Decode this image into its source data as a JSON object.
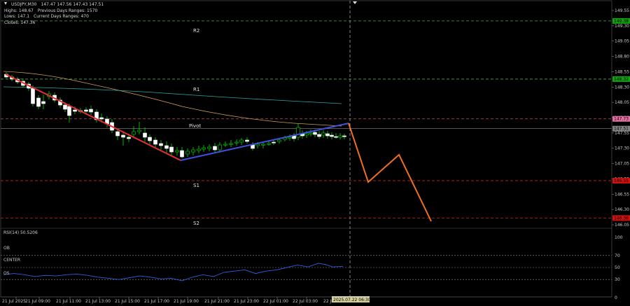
{
  "window": {
    "symbol": "USDJPY,M30",
    "ohlc": "147.47 147.56 147.43 147.51",
    "highs_label": "Highs: 148.67",
    "prev_range_label": "Previous Days Ranges: 1570",
    "lows_label": "Lows: 147.1",
    "curr_range_label": "Current Days Ranges: 470",
    "closes_label": "Closes: 147.36"
  },
  "levels": {
    "r2": "R2",
    "r1": "R1",
    "pivot": "Pivot",
    "s1": "S1",
    "s2": "S2"
  },
  "price_axis": {
    "ticks": [
      "149.55",
      "149.30",
      "149.05",
      "148.80",
      "148.55",
      "148.30",
      "148.05",
      "147.80",
      "147.55",
      "147.30",
      "147.05",
      "146.80",
      "146.55",
      "146.30",
      "146.05"
    ],
    "tags": {
      "r2": "149.38",
      "r1": "148.32",
      "pivot": "147.73",
      "current": "147.51",
      "s1": "146.55",
      "s2": "146.36"
    }
  },
  "rsi": {
    "title": "RSI(14) 50.5206",
    "ob_label": "OB",
    "center_label": "CENTER",
    "os_label": "OS",
    "ticks": [
      "100",
      "70",
      "50",
      "30",
      "0"
    ]
  },
  "time_axis": {
    "labels": [
      "21 Jul 2025",
      "21 Jul 09:00",
      "21 Jul 11:00",
      "21 Jul 13:00",
      "21 Jul 15:00",
      "21 Jul 17:00",
      "21 Jul 19:00",
      "21 Jul 21:00",
      "21 Jul 23:00",
      "22 Jul 01:00",
      "22 Jul 03:00",
      "22 Jul 05:00"
    ],
    "cursor_time": "2025.07.22 06:30"
  },
  "colors": {
    "background": "#000000",
    "bull_candle": "#ffffff",
    "bear_candle": "#ffffff",
    "wick": "#00e000",
    "grid_dash": "#3a6a3a",
    "pivot_line": "#c05060",
    "s_line": "#d02020",
    "r_line": "#5aa05a",
    "down_trend": "#e03030",
    "up_trend": "#4050e0",
    "forecast": "#f07020",
    "ma_slow": "#2aa8a0",
    "ma_fast": "#d0a050",
    "rsi_line": "#3060e0",
    "tag_green": "#10a010",
    "tag_red": "#d01010",
    "tag_pink": "#e070a0",
    "tag_gray": "#808080"
  }
}
